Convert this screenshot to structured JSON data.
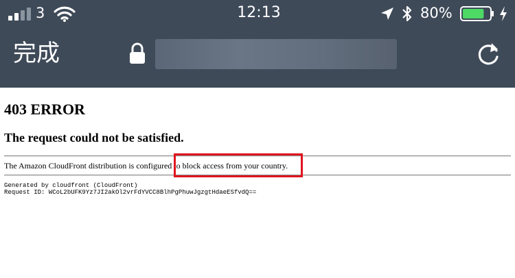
{
  "status_bar": {
    "carrier": "3",
    "time": "12:13",
    "battery_percent": "80%",
    "battery_level": 0.8
  },
  "nav_bar": {
    "done_label": "完成",
    "url": ""
  },
  "page": {
    "heading": "403 ERROR",
    "subheading": "The request could not be satisfied.",
    "message": "The Amazon CloudFront distribution is configured to block access from your country.",
    "generated_by": "Generated by cloudfront (CloudFront)",
    "request_id": "Request ID: WCoL2bUFK9Yz7JI2akOl2vrFdYVCC8BlhPgPhuwJgzgtHdaeESfvdQ=="
  },
  "colors": {
    "chrome_background": "#3f4a59",
    "battery_fill": "#4cd964",
    "highlight_border": "#e0141e"
  },
  "icons": [
    "signal-icon",
    "wifi-icon",
    "location-icon",
    "bluetooth-icon",
    "battery-icon",
    "charging-icon",
    "lock-icon",
    "reload-icon"
  ]
}
